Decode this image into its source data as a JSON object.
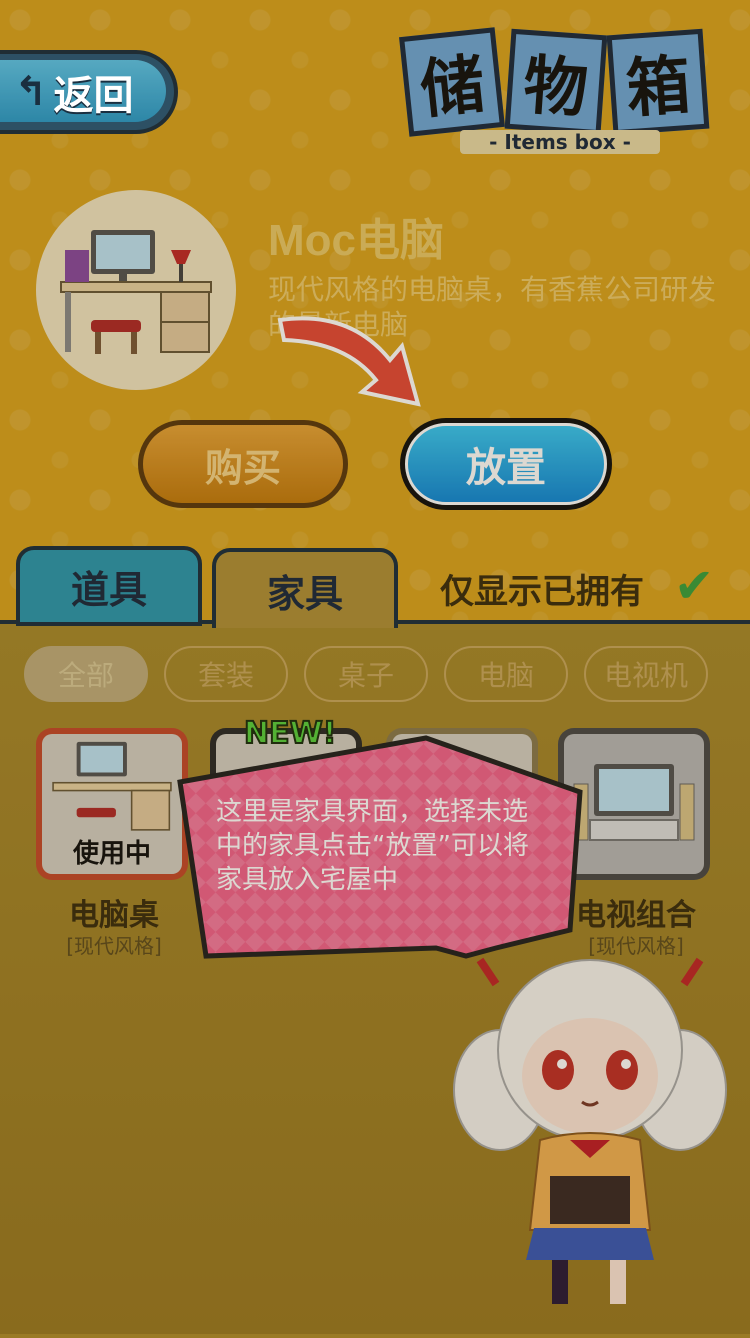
{
  "header": {
    "back_label": "返回",
    "title_chars": [
      "储",
      "物",
      "箱"
    ],
    "title_sub": "- Items box -"
  },
  "selected_item": {
    "name": "Moc电脑",
    "description": "现代风格的电脑桌，有香蕉公司研发的最新电脑"
  },
  "actions": {
    "buy_label": "购买",
    "place_label": "放置"
  },
  "tabs": {
    "items_label": "道具",
    "furniture_label": "家具",
    "owned_only_label": "仅显示已拥有"
  },
  "filters": [
    "全部",
    "套装",
    "桌子",
    "电脑",
    "电视机"
  ],
  "cards": [
    {
      "name": "电脑桌",
      "style": "[现代风格]",
      "status": "使用中"
    },
    {
      "name": "",
      "style": "",
      "badge": "NEW!"
    },
    {
      "name": "",
      "style": ""
    },
    {
      "name": "电视组合",
      "style": "[现代风格]"
    }
  ],
  "tutorial": {
    "text": "这里是家具界面，选择未选中的家具点击“放置”可以将家具放入宅屋中"
  },
  "colors": {
    "background": "#d9a420",
    "place_button": "#1c9ee0",
    "bubble": "#f2638e"
  }
}
